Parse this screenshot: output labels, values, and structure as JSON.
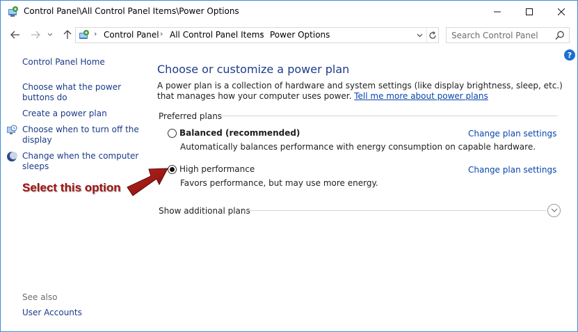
{
  "window": {
    "title": "Control Panel\\All Control Panel Items\\Power Options",
    "icon": "control-panel-icon"
  },
  "navigation": {
    "breadcrumbs": [
      "Control Panel",
      "All Control Panel Items",
      "Power Options"
    ],
    "search_placeholder": "Search Control Panel"
  },
  "sidebar": {
    "home": "Control Panel Home",
    "links": [
      {
        "label": "Choose what the power buttons do",
        "icon": null
      },
      {
        "label": "Create a power plan",
        "icon": null
      },
      {
        "label": "Choose when to turn off the display",
        "icon": "display-clock-icon"
      },
      {
        "label": "Change when the computer sleeps",
        "icon": "moon-icon"
      }
    ],
    "see_also_label": "See also",
    "see_also_links": [
      "User Accounts"
    ]
  },
  "main": {
    "title": "Choose or customize a power plan",
    "intro_text": "A power plan is a collection of hardware and system settings (like display brightness, sleep, etc.) that manages how your computer uses power.",
    "intro_link": "Tell me more about power plans",
    "group_label": "Preferred plans",
    "plans": [
      {
        "name": "Balanced (recommended)",
        "description": "Automatically balances performance with energy consumption on capable hardware.",
        "link": "Change plan settings",
        "selected": false
      },
      {
        "name": "High performance",
        "description": "Favors performance, but may use more energy.",
        "link": "Change plan settings",
        "selected": true
      }
    ],
    "more_plans_label": "Show additional plans"
  },
  "annotation": {
    "text": "Select this option",
    "color": "#a31212"
  },
  "colors": {
    "link": "#0645ad",
    "title": "#1e3b8a",
    "nav_link": "#1a3a87",
    "window_border": "#3c8dd9"
  }
}
